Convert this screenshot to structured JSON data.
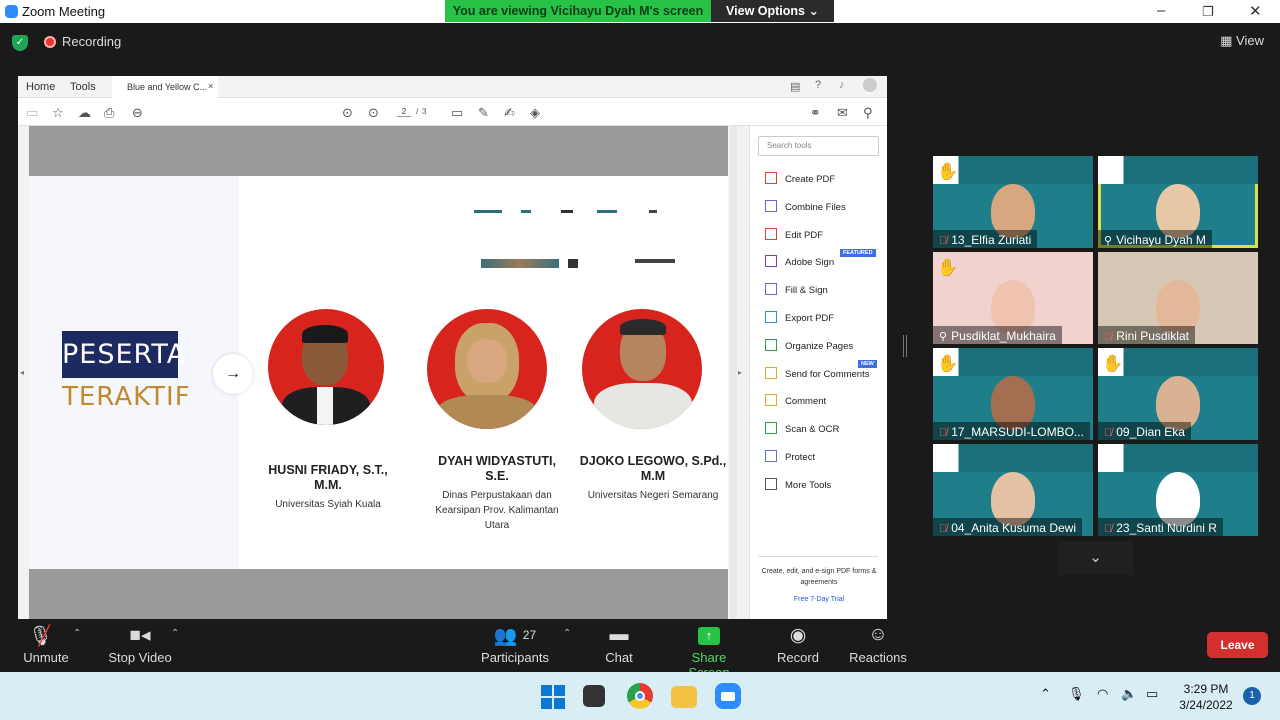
{
  "window": {
    "title": "Zoom Meeting",
    "minimize": "–",
    "maximize": "❐",
    "close": "✕"
  },
  "banner": {
    "text": "You are viewing Vicihayu Dyah M's screen",
    "view_options": "View Options ⌄"
  },
  "status": {
    "recording": "Recording",
    "view": "View"
  },
  "acrobat": {
    "tabs": {
      "home": "Home",
      "tools": "Tools",
      "document": "Blue and Yellow C...",
      "close": "×"
    },
    "page_current": "2",
    "page_sep": "/",
    "page_total": "3",
    "tools_search_placeholder": "Search tools",
    "tools": [
      {
        "label": "Create PDF",
        "color": "#e2403c"
      },
      {
        "label": "Combine Files",
        "color": "#7c5bd6"
      },
      {
        "label": "Edit PDF",
        "color": "#e2403c"
      },
      {
        "label": "Adobe Sign",
        "color": "#7c3cbd"
      },
      {
        "label": "Fill & Sign",
        "color": "#7c5bd6"
      },
      {
        "label": "Export PDF",
        "color": "#2c8cd6"
      },
      {
        "label": "Organize Pages",
        "color": "#27a046"
      },
      {
        "label": "Send for Comments",
        "color": "#e0a828"
      },
      {
        "label": "Comment",
        "color": "#e0a828"
      },
      {
        "label": "Scan & OCR",
        "color": "#27a046"
      },
      {
        "label": "Protect",
        "color": "#5b6fd6"
      },
      {
        "label": "More Tools",
        "color": "#555555"
      }
    ],
    "badge_featured": "FEATURED",
    "badge_new": "NEW",
    "promo_text": "Create, edit, and e-sign PDF forms & agreements",
    "promo_link": "Free 7-Day Trial"
  },
  "slide": {
    "title_line1": "PESERTA",
    "title_line2": "TERAKTIF",
    "people": [
      {
        "name": "HUSNI FRIADY, S.T., M.M.",
        "org": "Universitas Syiah Kuala"
      },
      {
        "name": "DYAH WIDYASTUTI, S.E.",
        "org": "Dinas Perpustakaan dan Kearsipan Prov. Kalimantan Utara"
      },
      {
        "name": "DJOKO LEGOWO, S.Pd., M.M",
        "org": "Universitas Negeri Semarang"
      }
    ]
  },
  "participants": [
    {
      "name": "13_Elfia Zuriati",
      "muted": true,
      "hand": true
    },
    {
      "name": "Vicihayu Dyah M",
      "muted": false,
      "hand": false,
      "active": true
    },
    {
      "name": "Pusdiklat_Mukhaira",
      "muted": false,
      "hand": true
    },
    {
      "name": "Rini Pusdiklat",
      "muted": true,
      "hand": false
    },
    {
      "name": "17_MARSUDI-LOMBO...",
      "muted": true,
      "hand": true
    },
    {
      "name": "09_Dian Eka",
      "muted": true,
      "hand": true
    },
    {
      "name": "04_Anita Kusuma Dewi",
      "muted": true,
      "hand": false
    },
    {
      "name": "23_Santi Nurdini R",
      "muted": true,
      "hand": false
    }
  ],
  "controls": {
    "unmute": "Unmute",
    "stop_video": "Stop Video",
    "participants": "Participants",
    "participants_count": "27",
    "chat": "Chat",
    "share_screen": "Share Screen",
    "record": "Record",
    "reactions": "Reactions",
    "leave": "Leave"
  },
  "taskbar": {
    "time": "3:29 PM",
    "date": "3/24/2022",
    "notifications": "1"
  }
}
